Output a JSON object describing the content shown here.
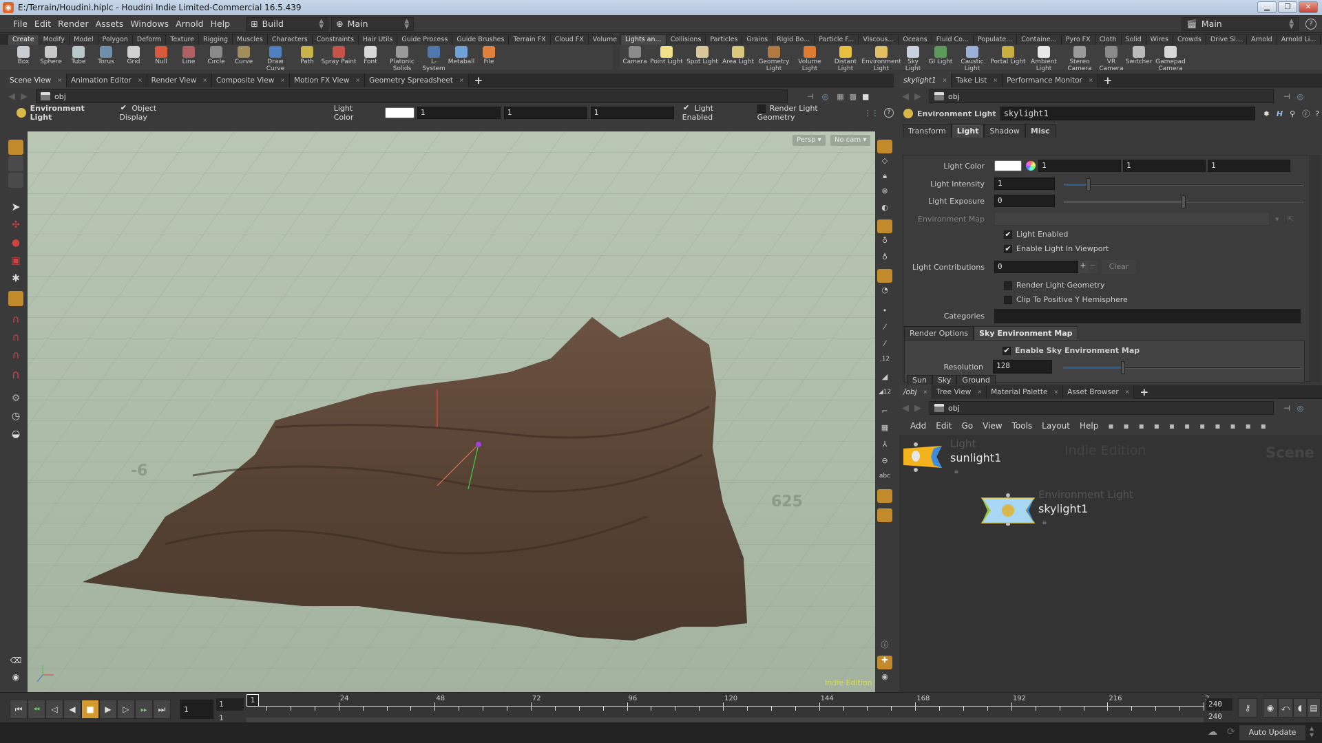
{
  "window": {
    "title": "E:/Terrain/Houdini.hiplc - Houdini Indie Limited-Commercial 16.5.439",
    "controls": [
      "minimize",
      "restore",
      "close"
    ]
  },
  "menubar": {
    "items": [
      "File",
      "Edit",
      "Render",
      "Assets",
      "Windows",
      "Arnold",
      "Help"
    ],
    "desktop_label": "Build",
    "desktop_icon": "layout-icon",
    "context_label": "Main",
    "right_context_label": "Main",
    "help_icon": "help-icon"
  },
  "shelf_left": {
    "tabs": [
      "Create",
      "Modify",
      "Model",
      "Polygon",
      "Deform",
      "Texture",
      "Rigging",
      "Muscles",
      "Characters",
      "Constraints",
      "Hair Utils",
      "Guide Process",
      "Guide Brushes",
      "Terrain FX",
      "Cloud FX",
      "Volume"
    ],
    "active_tab": "Create",
    "tools": [
      {
        "label": "Box",
        "icon": "box-icon",
        "color": "#c9ccd1"
      },
      {
        "label": "Sphere",
        "icon": "sphere-icon",
        "color": "#c8c8c8"
      },
      {
        "label": "Tube",
        "icon": "tube-icon",
        "color": "#b9c8c8"
      },
      {
        "label": "Torus",
        "icon": "torus-icon",
        "color": "#6f8fa8"
      },
      {
        "label": "Grid",
        "icon": "grid-icon",
        "color": "#d0d0d0"
      },
      {
        "label": "Null",
        "icon": "null-icon",
        "color": "#d65a3a"
      },
      {
        "label": "Line",
        "icon": "line-icon",
        "color": "#b06060"
      },
      {
        "label": "Circle",
        "icon": "circle-icon",
        "color": "#8a8a8a"
      },
      {
        "label": "Curve",
        "icon": "curve-icon",
        "color": "#a08d5a"
      },
      {
        "label": "Draw Curve",
        "icon": "draw-curve-icon",
        "color": "#4e7fbf"
      },
      {
        "label": "Path",
        "icon": "path-icon",
        "color": "#c9b24a"
      },
      {
        "label": "Spray Paint",
        "icon": "spray-paint-icon",
        "color": "#c6524a"
      },
      {
        "label": "Font",
        "icon": "font-icon",
        "color": "#d8d8d8"
      },
      {
        "label": "Platonic Solids",
        "icon": "platonic-solids-icon",
        "color": "#9a9a9a"
      },
      {
        "label": "L-System",
        "icon": "l-system-icon",
        "color": "#4f78b0"
      },
      {
        "label": "Metaball",
        "icon": "metaball-icon",
        "color": "#6fa0d8"
      },
      {
        "label": "File",
        "icon": "file-icon",
        "color": "#e0803a"
      }
    ]
  },
  "shelf_right": {
    "tabs": [
      "Lights an...",
      "Collisions",
      "Particles",
      "Grains",
      "Rigid Bo...",
      "Particle F...",
      "Viscous...",
      "Oceans",
      "Fluid Co...",
      "Populate...",
      "Containe...",
      "Pyro FX",
      "Cloth",
      "Solid",
      "Wires",
      "Crowds",
      "Drive Si...",
      "Arnold",
      "Arnold Li..."
    ],
    "active_tab": "Lights an...",
    "tools": [
      {
        "label": "Camera",
        "icon": "camera-icon",
        "color": "#8a8a8a"
      },
      {
        "label": "Point Light",
        "icon": "point-light-icon",
        "color": "#f1e08a"
      },
      {
        "label": "Spot Light",
        "icon": "spot-light-icon",
        "color": "#d9c79a"
      },
      {
        "label": "Area Light",
        "icon": "area-light-icon",
        "color": "#d8c67a"
      },
      {
        "label": "Geometry Light",
        "icon": "geometry-light-icon",
        "color": "#b07a40"
      },
      {
        "label": "Volume Light",
        "icon": "volume-light-icon",
        "color": "#e07a30"
      },
      {
        "label": "Distant Light",
        "icon": "distant-light-icon",
        "color": "#e8c040"
      },
      {
        "label": "Environment Light",
        "icon": "environment-light-icon",
        "color": "#e0c060"
      },
      {
        "label": "Sky Light",
        "icon": "sky-light-icon",
        "color": "#c8d0e0"
      },
      {
        "label": "GI Light",
        "icon": "gi-light-icon",
        "color": "#5a9a5a"
      },
      {
        "label": "Caustic Light",
        "icon": "caustic-light-icon",
        "color": "#9ab0d8"
      },
      {
        "label": "Portal Light",
        "icon": "portal-light-icon",
        "color": "#c8b040"
      },
      {
        "label": "Ambient Light",
        "icon": "ambient-light-icon",
        "color": "#e8e8e8"
      },
      {
        "label": "Stereo Camera",
        "icon": "stereo-camera-icon",
        "color": "#9a9a9a"
      },
      {
        "label": "VR Camera",
        "icon": "vr-camera-icon",
        "color": "#8a8a8a"
      },
      {
        "label": "Switcher",
        "icon": "switcher-icon",
        "color": "#bbbbbb"
      },
      {
        "label": "Gamepad Camera",
        "icon": "gamepad-camera-icon",
        "color": "#d8d8d8"
      }
    ]
  },
  "left_pane": {
    "tabs": [
      "Scene View",
      "Animation Editor",
      "Render View",
      "Composite View",
      "Motion FX View",
      "Geometry Spreadsheet"
    ],
    "active_tab": "Scene View",
    "path": "obj",
    "operator_bar": {
      "node_type": "Environment Light",
      "object_display_label": "Object Display",
      "object_display_checked": true,
      "light_color_label": "Light Color",
      "light_color": [
        "1",
        "1",
        "1"
      ],
      "light_enabled_label": "Light Enabled",
      "light_enabled_checked": true,
      "render_light_geometry_label": "Render Light Geometry",
      "render_light_geometry_checked": false
    },
    "viewport": {
      "view_menu": "Persp ▾",
      "camera_menu": "No cam ▾",
      "grid_labels": [
        "-6",
        "625"
      ],
      "watermark": "Indie Edition"
    }
  },
  "parameters": {
    "tabs": [
      "skylight1",
      "Take List",
      "Performance Monitor"
    ],
    "active_tab": "skylight1",
    "path": "obj",
    "node_type": "Environment Light",
    "node_name": "skylight1",
    "folder_tabs": [
      "Transform",
      "Light",
      "Shadow",
      "Misc"
    ],
    "active_folder": "Light",
    "light_color_label": "Light Color",
    "light_color": [
      "1",
      "1",
      "1"
    ],
    "light_intensity_label": "Light Intensity",
    "light_intensity": "1",
    "light_intensity_slider_fraction": 0.1,
    "light_exposure_label": "Light Exposure",
    "light_exposure": "0",
    "light_exposure_slider_fraction": 0.5,
    "environment_map_label": "Environment Map",
    "environment_map": "",
    "light_enabled_label": "Light Enabled",
    "light_enabled": true,
    "enable_in_viewport_label": "Enable Light In Viewport",
    "enable_in_viewport": true,
    "light_contributions_label": "Light Contributions",
    "light_contributions": "0",
    "clear_label": "Clear",
    "render_light_geometry_label": "Render Light Geometry",
    "render_light_geometry": false,
    "clip_label": "Clip To Positive Y Hemisphere",
    "clip": false,
    "categories_label": "Categories",
    "categories": "",
    "sub_tabs": [
      "Render Options",
      "Sky Environment Map"
    ],
    "active_sub_tab": "Sky Environment Map",
    "enable_sky_label": "Enable Sky Environment Map",
    "enable_sky": true,
    "resolution_label": "Resolution",
    "resolution": "128",
    "resolution_slider_fraction": 0.25,
    "sky_tabs": [
      "Sun",
      "Sky",
      "Ground"
    ]
  },
  "network": {
    "tabs": [
      "/obj",
      "Tree View",
      "Material Palette",
      "Asset Browser"
    ],
    "active_tab": "/obj",
    "path": "obj",
    "menu": [
      "Add",
      "Edit",
      "Go",
      "View",
      "Tools",
      "Layout",
      "Help"
    ],
    "watermark_edition": "Indie Edition",
    "watermark_context": "Scene",
    "nodes": [
      {
        "type": "Light",
        "name": "sunlight1"
      },
      {
        "type": "Environment Light",
        "name": "skylight1"
      }
    ]
  },
  "timeline": {
    "current_frame": "1",
    "start_frame": "1",
    "start_frame_2": "1",
    "playhead_label": "1",
    "tick_labels": [
      "24",
      "48",
      "72",
      "96",
      "120",
      "144",
      "168",
      "192",
      "216",
      "2"
    ],
    "end_frame": "240",
    "end_frame_2": "240",
    "range": [
      1,
      240
    ]
  },
  "statusbar": {
    "auto_update_label": "Auto Update"
  }
}
